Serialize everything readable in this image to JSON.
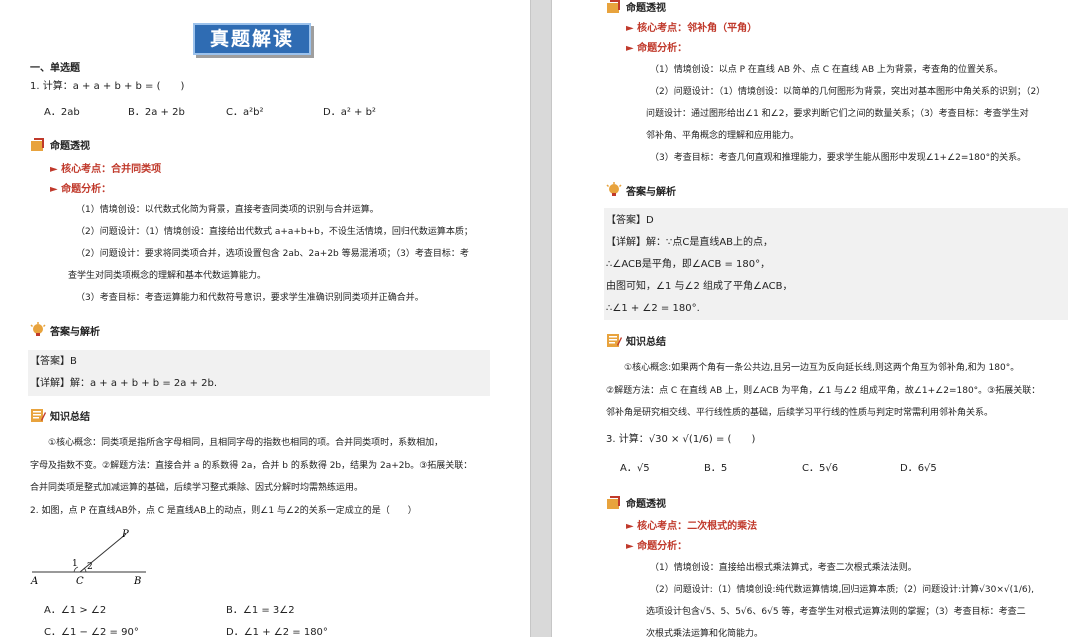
{
  "left": {
    "banner": "真题解读",
    "section": "一、单选题",
    "q1": {
      "stem": "1. 计算：a + a + b + b = (　　)",
      "options": [
        "A．2ab",
        "B．2a + 2b",
        "C．a²b²",
        "D．a² + b²"
      ]
    },
    "analysis_title": "命题透视",
    "kp": "► 核心考点：合并同类项",
    "analysis_label": "► 命题分析：",
    "analysis_lines": [
      "（1）情境创设：以代数式化简为背景，直接考查同类项的识别与合并运算。",
      "（2）问题设计：（1）情境创设：直接给出代数式 a+a+b+b，不设生活情境，回归代数运算本质；",
      "（2）问题设计：要求将同类项合并，选项设置包含 2ab、2a+2b 等易混淆项；（3）考查目标：考",
      "查学生对同类项概念的理解和基本代数运算能力。",
      "（3）考查目标：考查运算能力和代数符号意识，要求学生准确识别同类项并正确合并。"
    ],
    "answer_title": "答案与解析",
    "answer_lines": [
      "【答案】B",
      "【详解】解：a + a + b + b = 2a + 2b."
    ],
    "summary_title": "知识总结",
    "summary_lines": [
      "①核心概念：同类项是指所含字母相同，且相同字母的指数也相同的项。合并同类项时，系数相加，",
      "字母及指数不变。②解题方法：直接合并 a 的系数得 2a，合并 b 的系数得 2b，结果为 2a+2b。③拓展关联：",
      "合并同类项是整式加减运算的基础，后续学习整式乘除、因式分解时均需熟练运用。"
    ],
    "q2": {
      "stem": "2. 如图，点 P 在直线AB外，点 C 是直线AB上的动点，则∠1 与∠2的关系一定成立的是（　　）",
      "figure_labels": [
        "P",
        "1",
        "2",
        "A",
        "C",
        "B"
      ],
      "options": [
        "A．∠1 > ∠2",
        "B．∠1 = 3∠2",
        "C．∠1 − ∠2 = 90°",
        "D．∠1 + ∠2 = 180°"
      ]
    }
  },
  "right": {
    "analysis_title": "命题透视",
    "kp": "► 核心考点：邻补角（平角）",
    "analysis_label": "► 命题分析：",
    "analysis_lines": [
      "（1）情境创设：以点 P 在直线 AB 外、点 C 在直线 AB 上为背景，考查角的位置关系。",
      "（2）问题设计：（1）情境创设：以简单的几何图形为背景，突出对基本图形中角关系的识别；（2）",
      "问题设计：通过图形给出∠1 和∠2，要求判断它们之间的数量关系；（3）考查目标：考查学生对",
      "邻补角、平角概念的理解和应用能力。",
      "（3）考查目标：考查几何直观和推理能力，要求学生能从图形中发现∠1+∠2=180°的关系。"
    ],
    "answer_title": "答案与解析",
    "answer_lines": [
      "【答案】D",
      "【详解】解：∵点C是直线AB上的点，",
      "∴∠ACB是平角，即∠ACB = 180°，",
      "由图可知，∠1 与∠2 组成了平角∠ACB，",
      "∴∠1 + ∠2 = 180°."
    ],
    "summary_title": "知识总结",
    "summary_lines": [
      "①核心概念:如果两个角有一条公共边,且另一边互为反向延长线,则这两个角互为邻补角,和为 180°。",
      "②解题方法：点 C 在直线 AB 上，则∠ACB 为平角，∠1 与∠2 组成平角，故∠1+∠2=180°。③拓展关联：",
      "邻补角是研究相交线、平行线性质的基础，后续学习平行线的性质与判定时常需利用邻补角关系。"
    ],
    "q3": {
      "stem": "3. 计算：√30 × √(1/6) = (　　)",
      "options": [
        "A．√5",
        "B．5",
        "C．5√6",
        "D．6√5"
      ]
    },
    "analysis2_title": "命题透视",
    "kp2": "► 核心考点：二次根式的乘法",
    "analysis2_label": "► 命题分析：",
    "analysis2_lines": [
      "（1）情境创设：直接给出根式乘法算式，考查二次根式乘法法则。",
      "（2）问题设计:（1）情境创设:纯代数运算情境,回归运算本质;（2）问题设计:计算√30×√(1/6),",
      "选项设计包含√5、5、5√6、6√5 等，考查学生对根式运算法则的掌握；（3）考查目标：考查二",
      "次根式乘法运算和化简能力。"
    ]
  }
}
